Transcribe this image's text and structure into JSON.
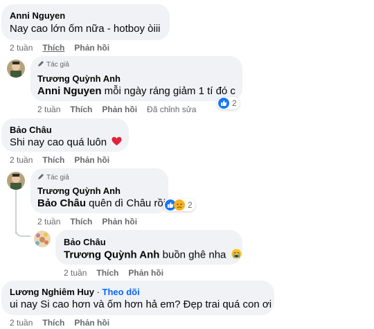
{
  "comments": [
    {
      "author": "Anni Nguyen",
      "text": "Nay cao lớn ốm nữa - hotboy òiii",
      "time": "2 tuần",
      "like": "Thích",
      "reply": "Phản hồi"
    },
    {
      "author_tag": "Tác giả",
      "author": "Trương Quỳnh Anh",
      "mention": "Anni Nguyen",
      "text": " mỗi ngày ráng giảm 1 tí đó c",
      "time": "2 tuần",
      "like": "Thích",
      "reply": "Phản hồi",
      "edited": "Đã chỉnh sửa",
      "reaction_count": "2"
    },
    {
      "author": "Bảo Châu",
      "text": "Shi nay cao quá luôn",
      "time": "2 tuần",
      "like": "Thích",
      "reply": "Phản hồi"
    },
    {
      "author_tag": "Tác giả",
      "author": "Trương Quỳnh Anh",
      "mention": "Bảo Châu",
      "text": " quên dì Châu rồi",
      "time": "2 tuần",
      "like": "Thích",
      "reply": "Phản hồi",
      "reaction_count": "2"
    },
    {
      "author": "Bảo Châu",
      "mention": "Trương Quỳnh Anh",
      "text": " buồn ghê nha",
      "time": "2 tuần",
      "like": "Thích",
      "reply": "Phản hồi"
    },
    {
      "author": "Lương Nghiêm Huy",
      "separator": "·",
      "follow": "Theo dõi",
      "text": "ui nay Si cao hơn và ốm hơn hả em? Đẹp trai quá con ơi",
      "time": "2 tuần",
      "like": "Thích",
      "reply": "Phản hồi"
    }
  ],
  "colors": {
    "bubble": "#f0f2f5",
    "meta": "#65676b",
    "link": "#0866ff",
    "like_blue": "#1877f2"
  },
  "icons": [
    "pencil-icon",
    "like-reaction-icon",
    "heart-emoji-icon",
    "sad-reaction-icon",
    "crying-emoji-icon"
  ]
}
